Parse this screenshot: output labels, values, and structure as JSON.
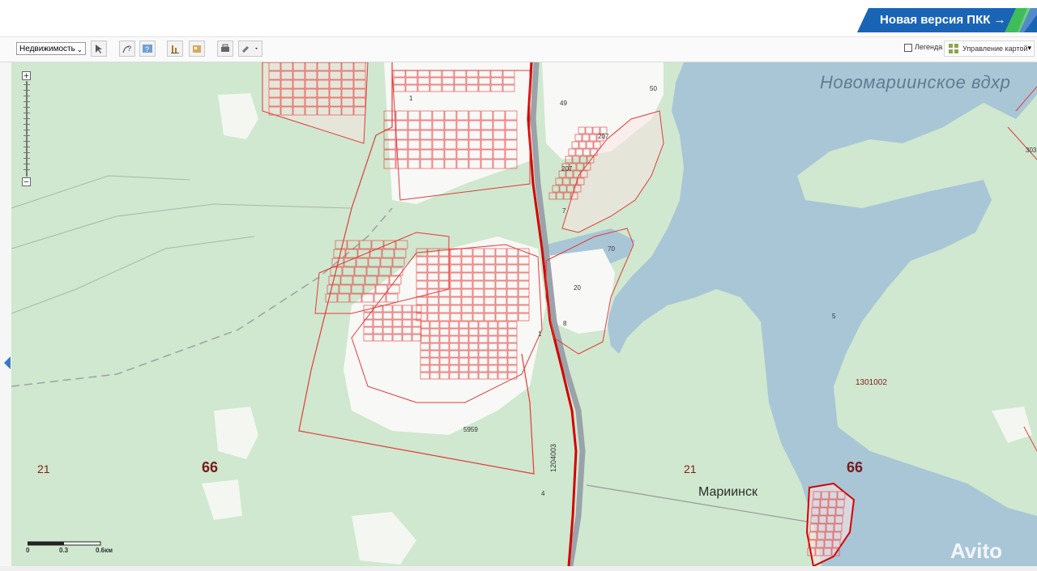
{
  "header": {
    "new_version_label": "Новая версия ПКК →",
    "accent_color": "#1a64b6",
    "stripe_color": "#3fbd5a"
  },
  "toolbar": {
    "layer_select_value": "Недвижимость",
    "legend_label": "Легенда",
    "map_control_label": "Управление картой",
    "icons": [
      "select-pointer-icon",
      "identify-icon",
      "search-map-icon",
      "measure-icon",
      "layers-icon",
      "print-icon",
      "link-icon"
    ]
  },
  "zoom": {
    "plus": "+",
    "minus": "−"
  },
  "map": {
    "reservoir_label": "Новомариинское вдхр",
    "town_label": "Мариинск",
    "region_labels": [
      "66",
      "66"
    ],
    "district_labels": [
      "21",
      "21"
    ],
    "cadastral_labels": {
      "quarter": "1301002",
      "road": "1204003",
      "zone_5959": "5959",
      "lake": "5",
      "p49": "49",
      "p50": "50",
      "p207a": "207",
      "p207b": "207",
      "p7": "7",
      "p70": "70",
      "p20": "20",
      "p8": "8",
      "p1": "1",
      "p1b": "1",
      "p4": "4",
      "p303": "303"
    },
    "colors": {
      "land": "#cfe8cf",
      "water": "#a9c6d7",
      "parcel": "#e33b3b",
      "road": "#d40000"
    }
  },
  "scale": {
    "labels": [
      "0",
      "0.3",
      "0.6км"
    ]
  },
  "watermark": "Avito"
}
